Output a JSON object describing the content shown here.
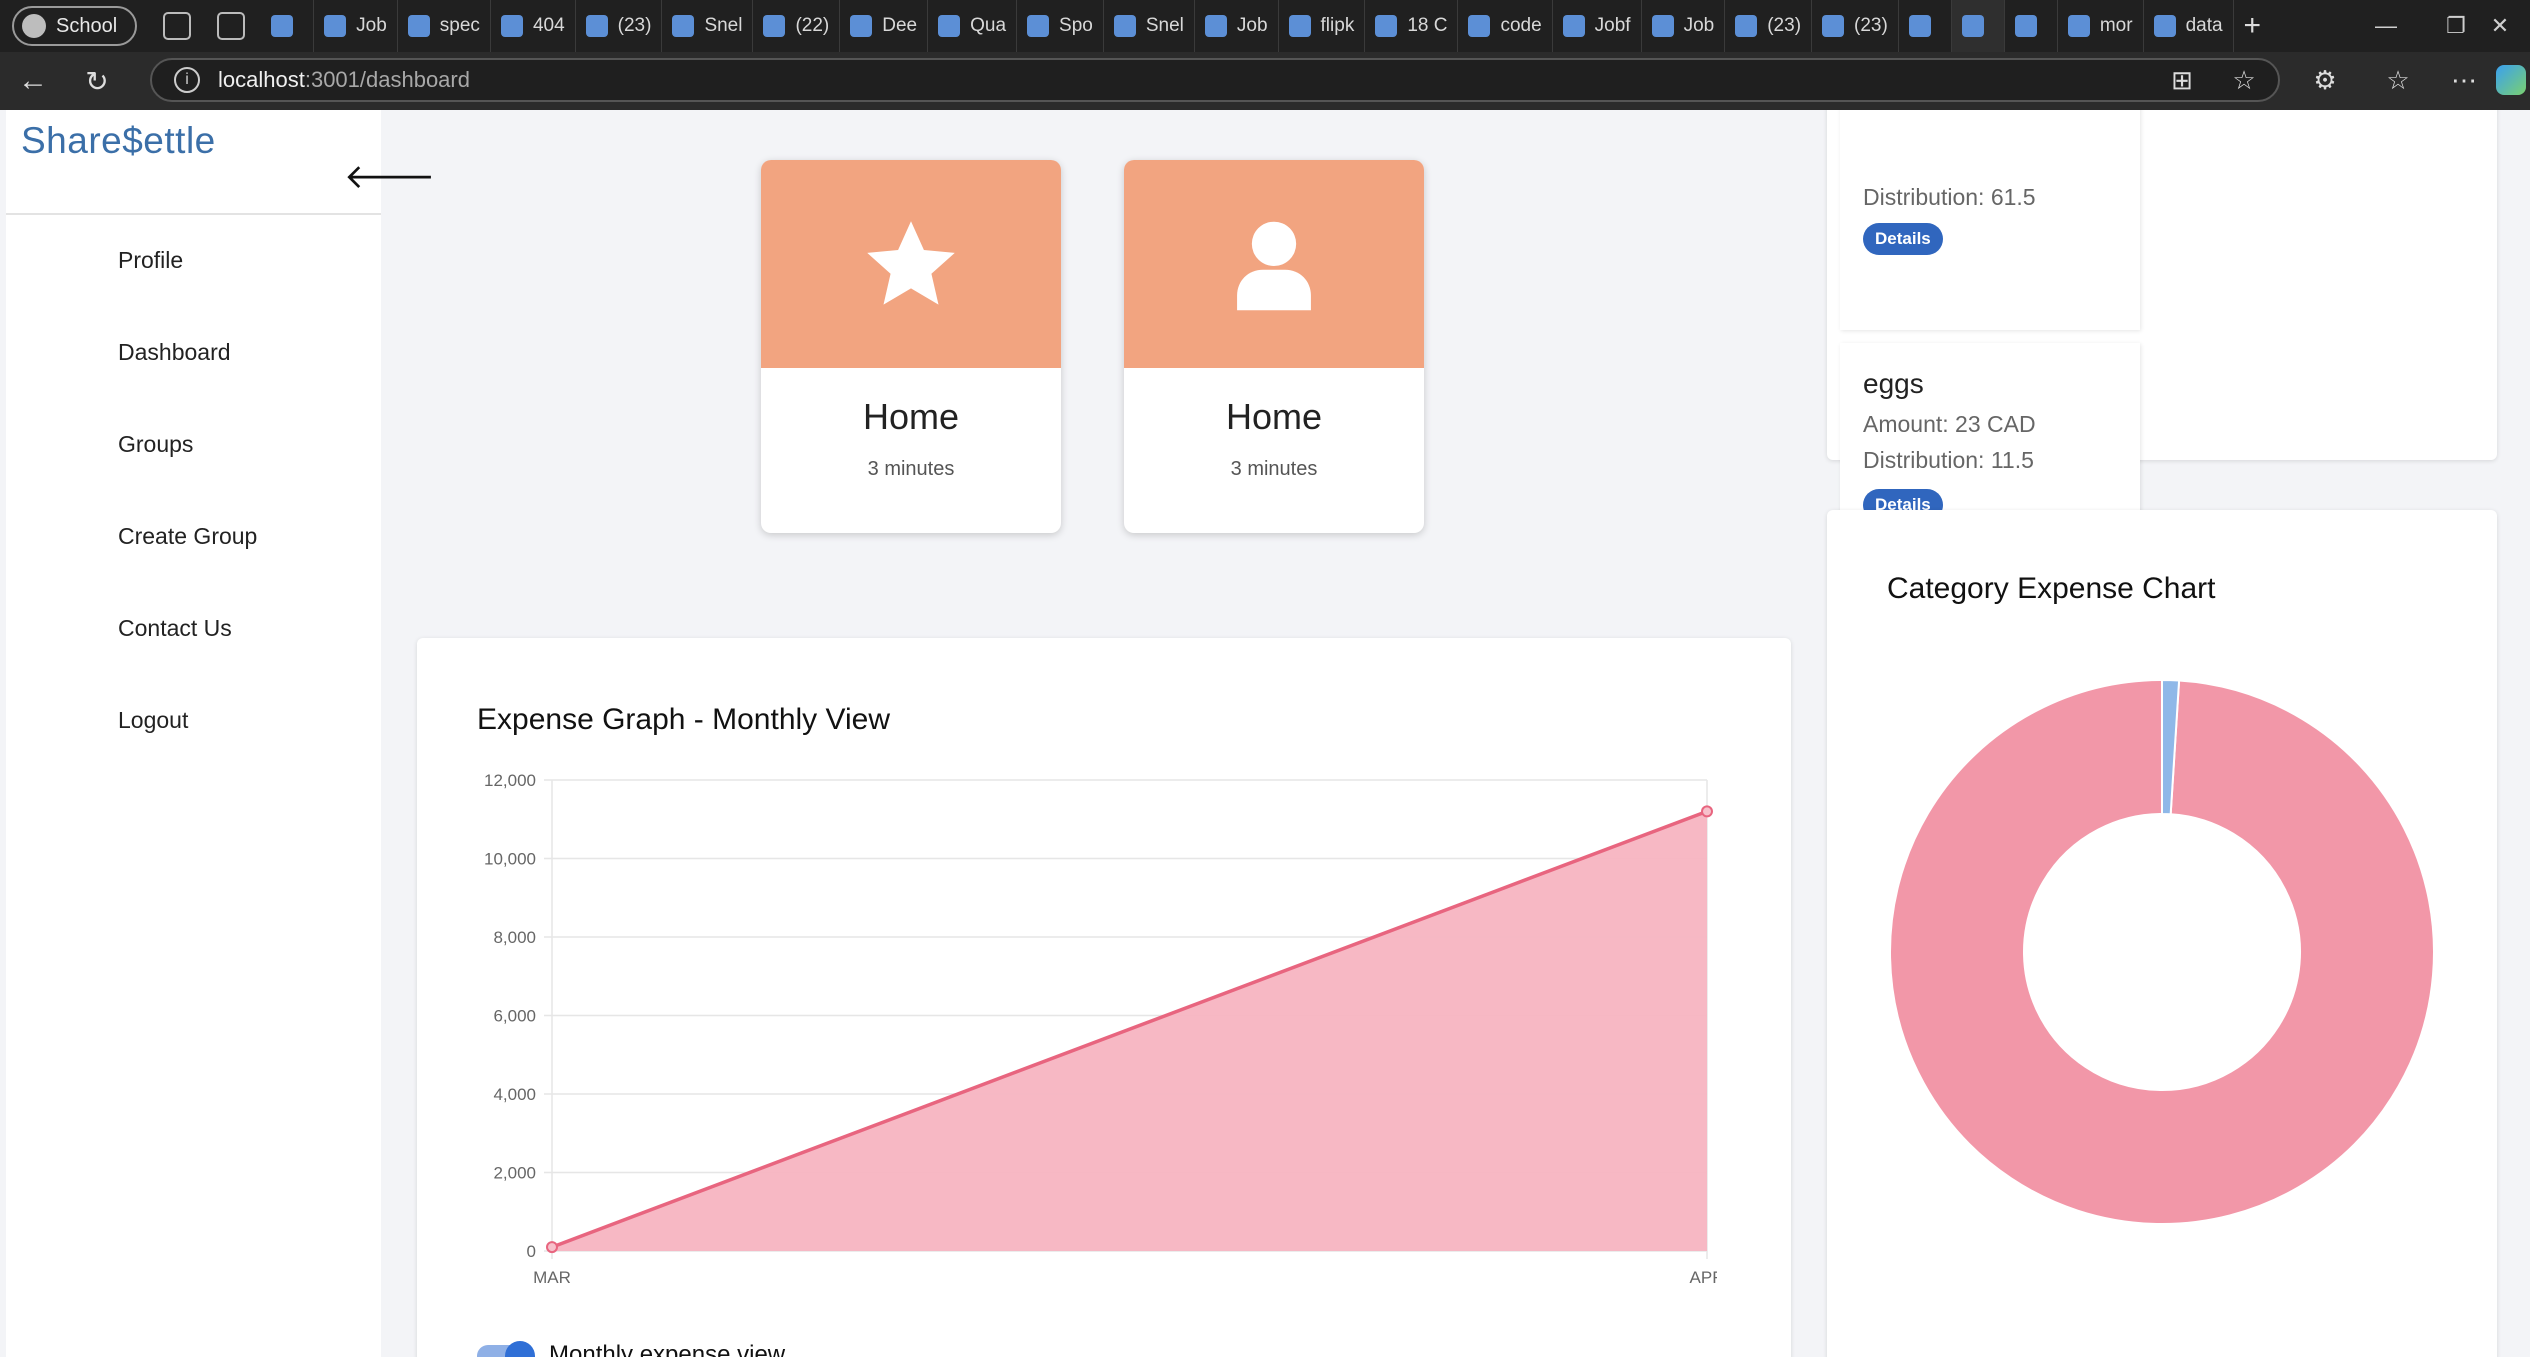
{
  "browser": {
    "profile_label": "School",
    "tabs": [
      {
        "label": ""
      },
      {
        "label": "Job"
      },
      {
        "label": "spec"
      },
      {
        "label": "404"
      },
      {
        "label": "(23)"
      },
      {
        "label": "Snel"
      },
      {
        "label": "(22)"
      },
      {
        "label": "Dee"
      },
      {
        "label": "Qua"
      },
      {
        "label": "Spo"
      },
      {
        "label": "Snel"
      },
      {
        "label": "Job"
      },
      {
        "label": "flipk"
      },
      {
        "label": "18 C"
      },
      {
        "label": "code"
      },
      {
        "label": "Jobf"
      },
      {
        "label": "Job"
      },
      {
        "label": "(23)"
      },
      {
        "label": "(23)"
      },
      {
        "label": ""
      },
      {
        "label": ""
      },
      {
        "label": ""
      },
      {
        "label": "mor"
      },
      {
        "label": "data"
      }
    ],
    "url_host": "localhost",
    "url_path": ":3001/dashboard",
    "new_tab_symbol": "+",
    "minimize_symbol": "—",
    "restore_symbol": "❐",
    "close_symbol": "✕"
  },
  "app": {
    "logo": "Share$ettle",
    "nav": [
      "Profile",
      "Dashboard",
      "Groups",
      "Create Group",
      "Contact Us",
      "Logout"
    ]
  },
  "cards": [
    {
      "title": "Home",
      "subtitle": "3 minutes",
      "icon": "star-icon"
    },
    {
      "title": "Home",
      "subtitle": "3 minutes",
      "icon": "user-icon"
    }
  ],
  "expenses": {
    "partial": {
      "line": "Distribution: 61.5",
      "button": "Details"
    },
    "items": [
      {
        "name": "eggs",
        "amount": "Amount: 23 CAD",
        "distribution": "Distribution: 11.5",
        "button": "Details"
      }
    ]
  },
  "line_chart_panel": {
    "title": "Expense Graph - Monthly View",
    "toggle_label": "Monthly expense view",
    "toggle_on": true
  },
  "category_panel": {
    "title": "Category Expense Chart"
  },
  "chart_data": [
    {
      "type": "area",
      "title": "Expense Graph - Monthly View",
      "categories": [
        "MAR",
        "APR"
      ],
      "series": [
        {
          "values": [
            100,
            11200
          ]
        }
      ],
      "y_ticks": [
        "0",
        "2,000",
        "4,000",
        "6,000",
        "8,000",
        "10,000",
        "12,000"
      ],
      "ylim": [
        0,
        12000
      ],
      "grid": true,
      "colors": {
        "line": "#e8657f",
        "fill": "#f7b4c1"
      }
    },
    {
      "type": "pie",
      "title": "Category Expense Chart",
      "series": [
        {
          "values": [
            99,
            1
          ]
        }
      ],
      "colors": [
        "#f297a8",
        "#8fb8e8"
      ]
    }
  ]
}
